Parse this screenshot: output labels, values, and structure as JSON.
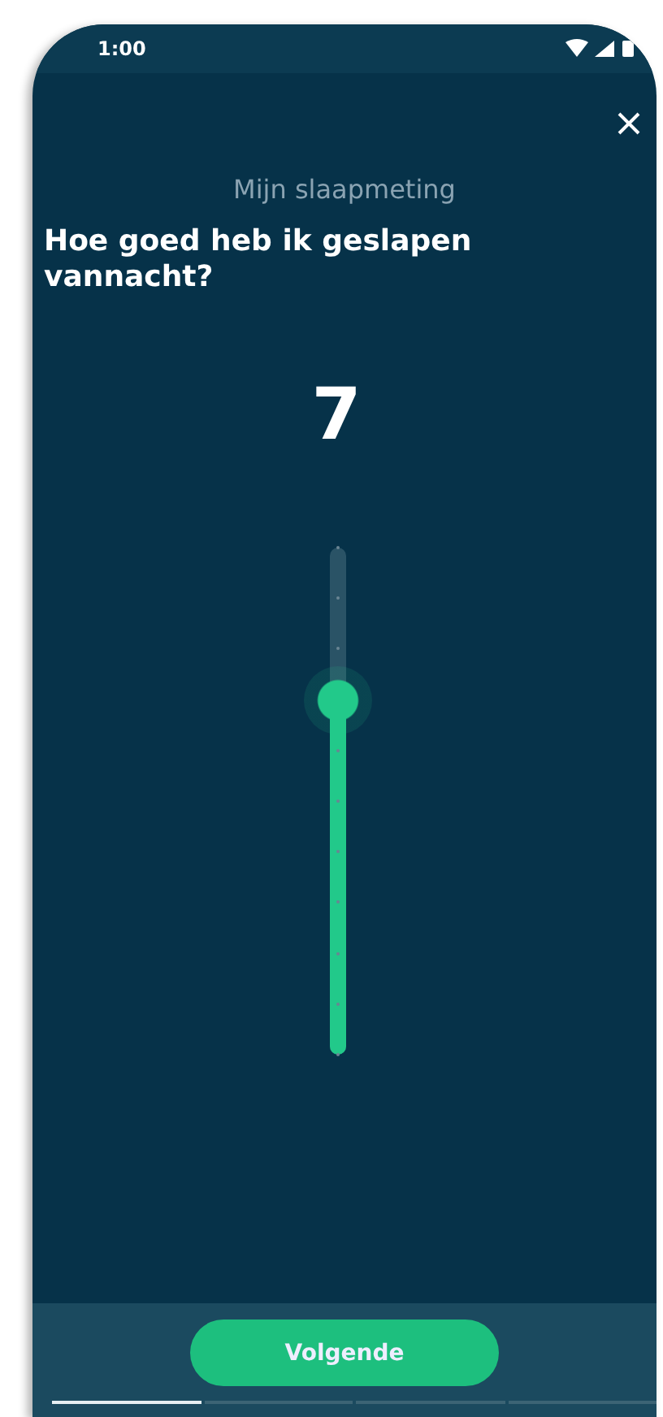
{
  "status_bar": {
    "time": "1:00"
  },
  "subtitle": "Mijn slaapmeting",
  "question": "Hoe goed heb ik geslapen vannacht?",
  "value": "7",
  "slider": {
    "level": 0.7
  },
  "button": "Volgende",
  "steps": [
    {
      "selected": true
    },
    {
      "selected": false
    },
    {
      "selected": false
    },
    {
      "selected": false
    }
  ]
}
